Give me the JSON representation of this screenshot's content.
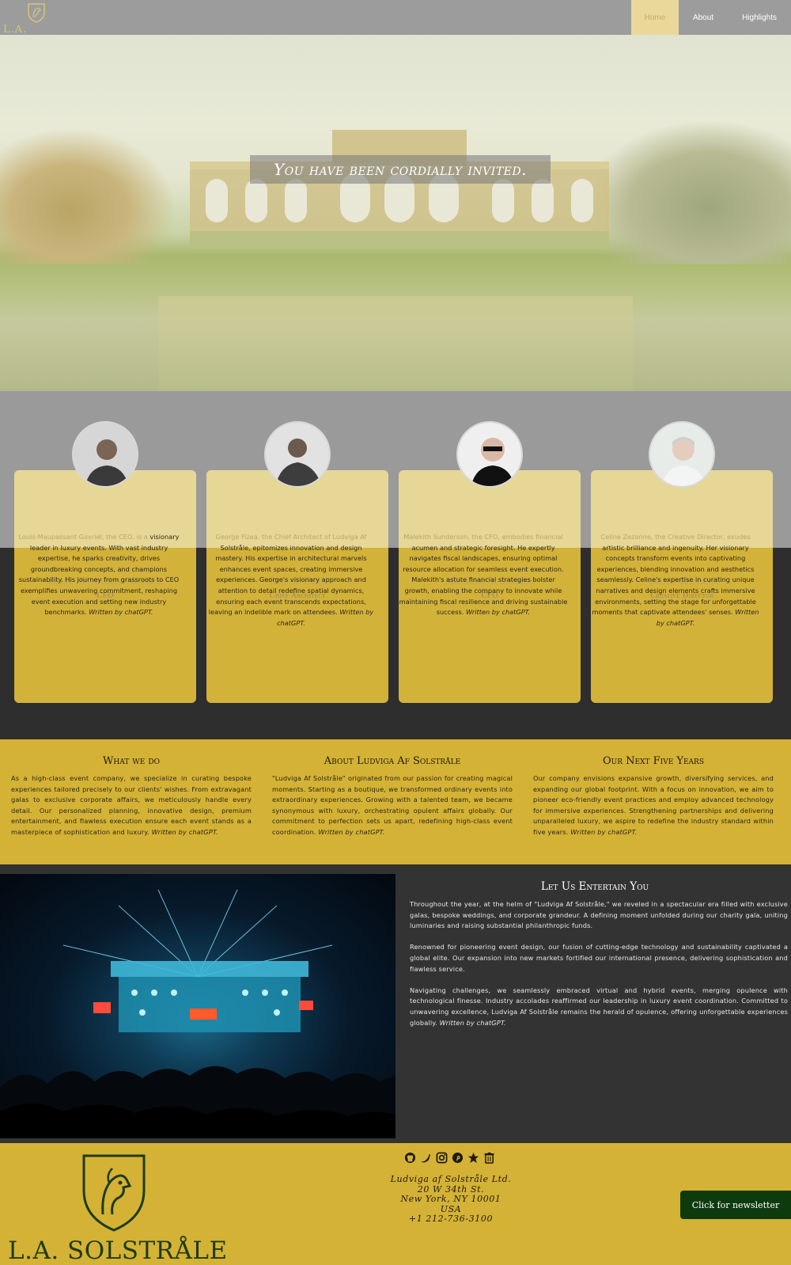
{
  "nav": {
    "brand": "L.A. SOLSTRÅLE",
    "links": [
      {
        "label": "Home"
      },
      {
        "label": "About"
      },
      {
        "label": "Highlights"
      }
    ]
  },
  "hero": {
    "title": "You have been cordially invited."
  },
  "team": {
    "members": [
      {
        "name": "Louis-Maupassant Gavriel",
        "role": "CEO",
        "bio_fade": "Louis-Maupassant Gavriel, the CEO, is a",
        "bio": "visionary leader in luxury events. With vast industry expertise, he sparks creativity, drives groundbreaking concepts, and champions sustainability. His journey from grassroots to CEO exemplifies unwavering commitment, reshaping event execution and setting new industry benchmarks.",
        "credit": "Written by chatGPT."
      },
      {
        "name": "George Fizea",
        "role": "Chief Architect",
        "bio_fade": "George Fizea, the Chief Architect of Ludviga Af",
        "bio": "Solstråle, epitomizes innovation and design mastery. His expertise in architectural marvels enhances event spaces, creating immersive experiences. George's visionary approach and attention to detail redefine spatial dynamics, ensuring each event transcends expectations, leaving an indelible mark on attendees.",
        "credit": "Written by chatGPT."
      },
      {
        "name": "Malekith Sunderson",
        "role": "CFO",
        "bio_fade": "Malekith Sunderson, the CFO, embodies financial",
        "bio": "acumen and strategic foresight. He expertly navigates fiscal landscapes, ensuring optimal resource allocation for seamless event execution. Malekith's astute financial strategies bolster growth, enabling the company to innovate while maintaining fiscal resilience and driving sustainable success.",
        "credit": "Written by chatGPT."
      },
      {
        "name": "Celine Zezanne",
        "role": "Creative Director",
        "bio_fade": "Celine Zezanne, the Creative Director, exudes",
        "bio": "artistic brilliance and ingenuity. Her visionary concepts transform events into captivating experiences, blending innovation and aesthetics seamlessly. Celine's expertise in curating unique narratives and design elements crafts immersive environments, setting the stage for unforgettable moments that captivate attendees' senses.",
        "credit": "Written by chatGPT."
      }
    ]
  },
  "info": {
    "columns": [
      {
        "title": "What we do",
        "text": "As a high-class event company, we specialize in curating bespoke experiences tailored precisely to our clients' wishes. From extravagant galas to exclusive corporate affairs, we meticulously handle every detail. Our personalized planning, innovative design, premium entertainment, and flawless execution ensure each event stands as a masterpiece of sophistication and luxury.",
        "credit": "Written by chatGPT."
      },
      {
        "title": "About Ludviga Af Solstråle",
        "text": "\"Ludviga Af Solstråle\" originated from our passion for creating magical moments. Starting as a boutique, we transformed ordinary events into extraordinary experiences. Growing with a talented team, we became synonymous with luxury, orchestrating opulent affairs globally. Our commitment to perfection sets us apart, redefining high-class event coordination.",
        "credit": "Written by chatGPT."
      },
      {
        "title": "Our Next Five Years",
        "text": "Our company envisions expansive growth, diversifying services, and expanding our global footprint. With a focus on innovation, we aim to pioneer eco-friendly event practices and employ advanced technology for immersive experiences. Strengthening partnerships and delivering unparalleled luxury, we aspire to redefine the industry standard within five years.",
        "credit": "Written by chatGPT."
      }
    ]
  },
  "entertain": {
    "title": "Let Us Entertain You",
    "p1": "Throughout the year, at the helm of \"Ludviga Af Solstråle,\" we reveled in a spectacular era filled with exclusive galas, bespoke weddings, and corporate grandeur. A defining moment unfolded during our charity gala, uniting luminaries and raising substantial philanthropic funds.",
    "p2": "Renowned for pioneering event design, our fusion of cutting-edge technology and sustainability captivated a global elite. Our expansion into new markets fortified our international presence, delivering sophistication and flawless service.",
    "p3": "Navigating challenges, we seamlessly embraced virtual and hybrid events, merging opulence with technological finesse. Industry accolades reaffirmed our leadership in luxury event coordination. Committed to unwavering excellence, Ludviga Af Solstråle remains the herald of opulence, offering unforgettable experiences globally.",
    "credit": "Written by chatGPT."
  },
  "footer": {
    "brand": "L.A. SOLSTRÅLE",
    "social_icons": [
      "github-icon",
      "twitter-icon",
      "instagram-icon",
      "pinterest-icon",
      "star-icon",
      "trash-icon"
    ],
    "address": {
      "company": "Ludviga af Solstråle Ltd.",
      "street": "20 W 34th St.",
      "city": "New York, NY 10001",
      "country": "USA",
      "phone": "+1 212-736-3100"
    },
    "newsletter_label": "Click for newsletter"
  },
  "colors": {
    "gold": "#d4b235",
    "dark": "#2e2e2e",
    "green_button": "#0e3b0e",
    "nav_grey": "#9c9c9c"
  }
}
